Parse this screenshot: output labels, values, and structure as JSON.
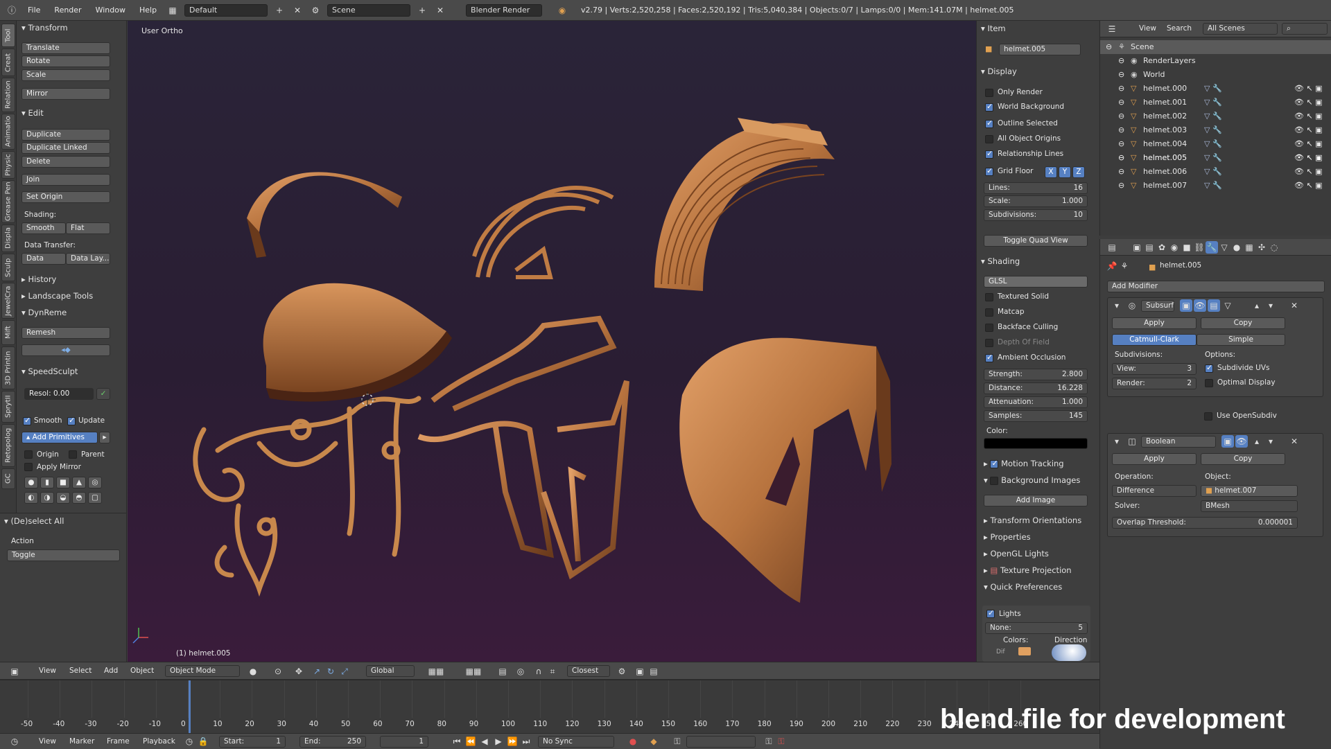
{
  "topbar": {
    "menus": [
      "File",
      "Render",
      "Window",
      "Help"
    ],
    "layout": "Default",
    "scene": "Scene",
    "engine": "Blender Render",
    "stats": "v2.79 | Verts:2,520,258 | Faces:2,520,192 | Tris:5,040,384 | Objects:0/7 | Lamps:0/0 | Mem:141.07M | helmet.005"
  },
  "vtabs": [
    "Tool",
    "Creat",
    "Relation",
    "Animatio",
    "Physic",
    "Grease Pen",
    "Displa",
    "Sculp",
    "JewelCra",
    "Mift",
    "3D Printin",
    "SprytII",
    "Retopolog",
    "GC"
  ],
  "toolshelf": {
    "transform": {
      "title": "Transform",
      "buttons": [
        "Translate",
        "Rotate",
        "Scale",
        "Mirror"
      ]
    },
    "edit": {
      "title": "Edit",
      "buttons": [
        "Duplicate",
        "Duplicate Linked",
        "Delete",
        "Join"
      ],
      "set_origin": "Set Origin",
      "shading_label": "Shading:",
      "smooth": "Smooth",
      "flat": "Flat",
      "data_transfer_label": "Data Transfer:",
      "data": "Data",
      "data_lay": "Data Lay..."
    },
    "history": "History",
    "landscape": "Landscape Tools",
    "dynreme": {
      "title": "DynReme",
      "remesh": "Remesh"
    },
    "speedsculpt": {
      "title": "SpeedSculpt",
      "resol": "Resol:  0.00",
      "smooth": "Smooth",
      "update": "Update",
      "add_primitives": "Add Primitives",
      "origin": "Origin",
      "parent": "Parent",
      "apply_mirror": "Apply Mirror"
    },
    "deselect": {
      "title": "(De)select All",
      "action_label": "Action",
      "action_value": "Toggle"
    }
  },
  "viewport": {
    "label": "User Ortho",
    "object_label": "(1) helmet.005",
    "accent": "#b8743f"
  },
  "npanel": {
    "item": {
      "title": "Item",
      "name": "helmet.005"
    },
    "display": {
      "title": "Display",
      "only_render": "Only Render",
      "world_background": "World Background",
      "outline_selected": "Outline Selected",
      "all_object_origins": "All Object Origins",
      "relationship_lines": "Relationship Lines",
      "grid_floor": "Grid Floor",
      "x": "X",
      "y": "Y",
      "z": "Z",
      "lines_label": "Lines:",
      "lines_value": "16",
      "scale_label": "Scale:",
      "scale_value": "1.000",
      "subdiv_label": "Subdivisions:",
      "subdiv_value": "10",
      "toggle_quad": "Toggle Quad View"
    },
    "shading": {
      "title": "Shading",
      "mode": "GLSL",
      "textured_solid": "Textured Solid",
      "matcap": "Matcap",
      "backface": "Backface Culling",
      "dof": "Depth Of Field",
      "ao": "Ambient Occlusion",
      "strength_label": "Strength:",
      "strength_value": "2.800",
      "distance_label": "Distance:",
      "distance_value": "16.228",
      "attenuation_label": "Attenuation:",
      "attenuation_value": "1.000",
      "samples_label": "Samples:",
      "samples_value": "145",
      "color_label": "Color:"
    },
    "motion_tracking": "Motion Tracking",
    "background_images": "Background Images",
    "add_image": "Add Image",
    "transform_orientations": "Transform Orientations",
    "properties": "Properties",
    "opengl_lights": "OpenGL Lights",
    "texture_projection": "Texture Projection",
    "quick_prefs": "Quick Preferences",
    "lights": "Lights",
    "none_label": "None:",
    "none_value": "5",
    "colors_label": "Colors:",
    "direction_label": "Direction",
    "diffuse_short": "Dif"
  },
  "outliner": {
    "header": {
      "view": "View",
      "search": "Search",
      "scenes": "All Scenes"
    },
    "items": [
      {
        "label": "Scene",
        "level": 0
      },
      {
        "label": "RenderLayers",
        "level": 1
      },
      {
        "label": "World",
        "level": 1
      },
      {
        "label": "helmet.000",
        "level": 1
      },
      {
        "label": "helmet.001",
        "level": 1
      },
      {
        "label": "helmet.002",
        "level": 1
      },
      {
        "label": "helmet.003",
        "level": 1
      },
      {
        "label": "helmet.004",
        "level": 1
      },
      {
        "label": "helmet.005",
        "level": 1
      },
      {
        "label": "helmet.006",
        "level": 1
      },
      {
        "label": "helmet.007",
        "level": 1
      }
    ]
  },
  "properties": {
    "object_name": "helmet.005",
    "add_modifier": "Add Modifier",
    "subsurf": {
      "name": "Subsurf",
      "apply": "Apply",
      "copy": "Copy",
      "catmull": "Catmull-Clark",
      "simple": "Simple",
      "subdivisions_label": "Subdivisions:",
      "view_label": "View:",
      "view_value": "3",
      "render_label": "Render:",
      "render_value": "2",
      "options_label": "Options:",
      "subdivide_uvs": "Subdivide UVs",
      "optimal_display": "Optimal Display",
      "use_opensubdiv": "Use OpenSubdiv"
    },
    "boolean": {
      "name": "Boolean",
      "apply": "Apply",
      "copy": "Copy",
      "operation_label": "Operation:",
      "operation_value": "Difference",
      "object_label": "Object:",
      "object_value": "helmet.007",
      "solver_label": "Solver:",
      "solver_value": "BMesh",
      "overlap_label": "Overlap Threshold:",
      "overlap_value": "0.000001"
    }
  },
  "viewport_header": {
    "view": "View",
    "select": "Select",
    "add": "Add",
    "object": "Object",
    "mode": "Object Mode",
    "orientation": "Global",
    "snap": "Closest"
  },
  "timeline": {
    "ticks": [
      "-50",
      "-40",
      "-30",
      "-20",
      "-10",
      "0",
      "10",
      "20",
      "30",
      "40",
      "50",
      "60",
      "70",
      "80",
      "90",
      "100",
      "110",
      "120",
      "130",
      "140",
      "150",
      "160",
      "170",
      "180",
      "190",
      "200",
      "210",
      "220",
      "230",
      "240",
      "250",
      "260"
    ],
    "menus": [
      "View",
      "Marker",
      "Frame",
      "Playback"
    ],
    "start_label": "Start:",
    "start_value": "1",
    "end_label": "End:",
    "end_value": "250",
    "current": "1",
    "sync": "No Sync",
    "playhead_frame": 0
  },
  "watermark": "blend file for development"
}
